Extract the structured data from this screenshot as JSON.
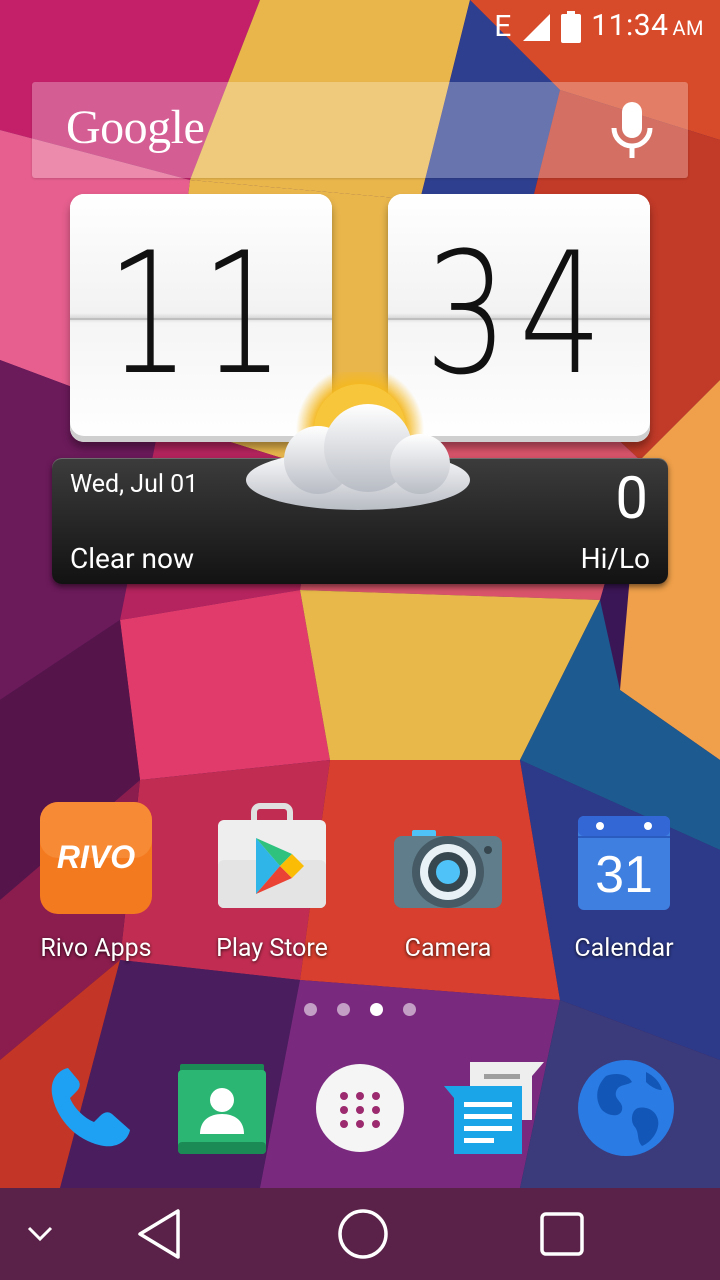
{
  "status_bar": {
    "network": "E",
    "time": "11:34",
    "ampm": "AM",
    "icons": [
      "signal-icon",
      "battery-icon"
    ]
  },
  "search": {
    "logo_text": "Google",
    "mic_icon": "microphone-icon"
  },
  "clock": {
    "hours": "11",
    "minutes": "34"
  },
  "weather": {
    "date": "Wed, Jul 01",
    "condition": "Clear now",
    "temperature": "0",
    "hilo": "Hi/Lo",
    "icon": "partly-cloudy-icon"
  },
  "apps": [
    {
      "label": "Rivo Apps",
      "icon": "rivo-icon",
      "icon_text": "RIVO"
    },
    {
      "label": "Play Store",
      "icon": "play-store-icon"
    },
    {
      "label": "Camera",
      "icon": "camera-icon"
    },
    {
      "label": "Calendar",
      "icon": "calendar-icon",
      "icon_text": "31"
    }
  ],
  "page_indicator": {
    "count": 4,
    "active_index": 2
  },
  "dock": [
    {
      "name": "phone",
      "icon": "phone-icon"
    },
    {
      "name": "contacts",
      "icon": "contacts-icon"
    },
    {
      "name": "all-apps",
      "icon": "app-drawer-icon"
    },
    {
      "name": "messaging",
      "icon": "messaging-icon"
    },
    {
      "name": "browser",
      "icon": "globe-icon"
    }
  ],
  "navbar": {
    "icons": [
      "chevron-down-icon",
      "back-icon",
      "home-icon",
      "recents-icon"
    ]
  },
  "colors": {
    "rivo_orange": "#F47A20",
    "phone_blue": "#1EA1F2",
    "contacts_green": "#2BB673",
    "calendar_blue": "#3F7FE0",
    "camera_gray": "#607D8B",
    "globe_blue": "#2A7BE4"
  }
}
